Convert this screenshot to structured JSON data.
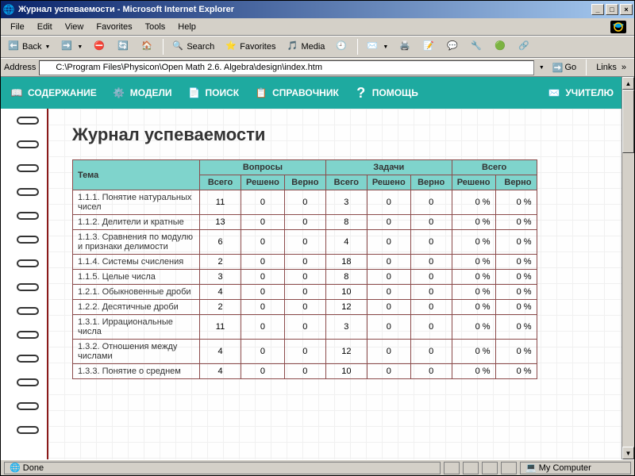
{
  "window": {
    "title": "Журнал успеваемости - Microsoft Internet Explorer"
  },
  "menu": {
    "file": "File",
    "edit": "Edit",
    "view": "View",
    "favorites": "Favorites",
    "tools": "Tools",
    "help": "Help"
  },
  "toolbar": {
    "back": "Back",
    "search": "Search",
    "favorites": "Favorites",
    "media": "Media"
  },
  "address": {
    "label": "Address",
    "value": "C:\\Program Files\\Physicon\\Open Math 2.6. Algebra\\design\\index.htm",
    "go": "Go",
    "links": "Links"
  },
  "appnav": {
    "contents": "СОДЕРЖАНИЕ",
    "models": "МОДЕЛИ",
    "search": "ПОИСК",
    "reference": "СПРАВОЧНИК",
    "help": "ПОМОЩЬ",
    "teacher": "УЧИТЕЛЮ"
  },
  "page_title": "Журнал успеваемости",
  "table": {
    "headers": {
      "topic": "Тема",
      "questions": "Вопросы",
      "tasks": "Задачи",
      "total": "Всего",
      "all": "Всего",
      "solved": "Решено",
      "correct": "Верно"
    },
    "rows": [
      {
        "topic": "1.1.1. Понятие натуральных чисел",
        "q": [
          11,
          0,
          0
        ],
        "t": [
          3,
          0,
          0
        ],
        "tot": [
          "0 %",
          "0 %"
        ]
      },
      {
        "topic": "1.1.2. Делители и кратные",
        "q": [
          13,
          0,
          0
        ],
        "t": [
          8,
          0,
          0
        ],
        "tot": [
          "0 %",
          "0 %"
        ]
      },
      {
        "topic": "1.1.3. Сравнения по модулю и признаки делимости",
        "q": [
          6,
          0,
          0
        ],
        "t": [
          4,
          0,
          0
        ],
        "tot": [
          "0 %",
          "0 %"
        ]
      },
      {
        "topic": "1.1.4. Системы счисления",
        "q": [
          2,
          0,
          0
        ],
        "t": [
          18,
          0,
          0
        ],
        "tot": [
          "0 %",
          "0 %"
        ]
      },
      {
        "topic": "1.1.5. Целые числа",
        "q": [
          3,
          0,
          0
        ],
        "t": [
          8,
          0,
          0
        ],
        "tot": [
          "0 %",
          "0 %"
        ]
      },
      {
        "topic": "1.2.1. Обыкновенные дроби",
        "q": [
          4,
          0,
          0
        ],
        "t": [
          10,
          0,
          0
        ],
        "tot": [
          "0 %",
          "0 %"
        ]
      },
      {
        "topic": "1.2.2. Десятичные дроби",
        "q": [
          2,
          0,
          0
        ],
        "t": [
          12,
          0,
          0
        ],
        "tot": [
          "0 %",
          "0 %"
        ]
      },
      {
        "topic": "1.3.1. Иррациональные числа",
        "q": [
          11,
          0,
          0
        ],
        "t": [
          3,
          0,
          0
        ],
        "tot": [
          "0 %",
          "0 %"
        ]
      },
      {
        "topic": "1.3.2. Отношения между числами",
        "q": [
          4,
          0,
          0
        ],
        "t": [
          12,
          0,
          0
        ],
        "tot": [
          "0 %",
          "0 %"
        ]
      },
      {
        "topic": "1.3.3. Понятие о среднем",
        "q": [
          4,
          0,
          0
        ],
        "t": [
          10,
          0,
          0
        ],
        "tot": [
          "0 %",
          "0 %"
        ]
      }
    ]
  },
  "status": {
    "done": "Done",
    "zone": "My Computer"
  }
}
